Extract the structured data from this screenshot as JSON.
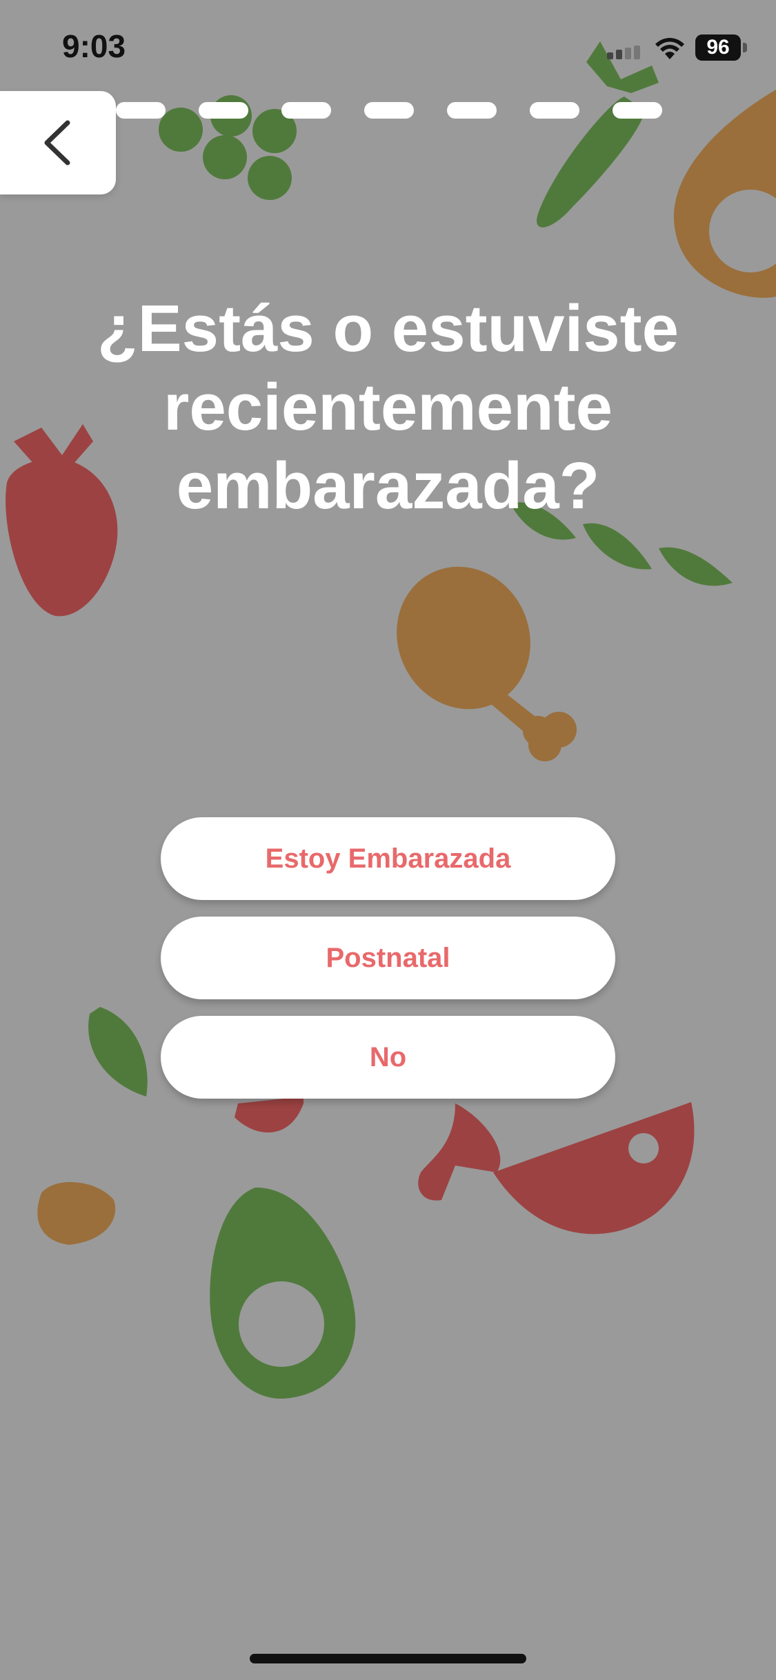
{
  "status_bar": {
    "time": "9:03",
    "battery": "96",
    "icons": [
      "signal-icon",
      "wifi-icon",
      "battery-icon"
    ]
  },
  "nav": {
    "back_icon": "chevron-left-icon",
    "progress_steps_total": 7
  },
  "question": {
    "line1": "¿Estás o estuviste",
    "line2": "recientemente",
    "line3": "embarazada?"
  },
  "options": [
    {
      "label": "Estoy Embarazada"
    },
    {
      "label": "Postnatal"
    },
    {
      "label": "No"
    }
  ],
  "colors": {
    "background": "#9a9a9a",
    "accent_text": "#e8696b",
    "green": "#507a3c",
    "red": "#9c4242",
    "brown": "#9a6f3c"
  }
}
